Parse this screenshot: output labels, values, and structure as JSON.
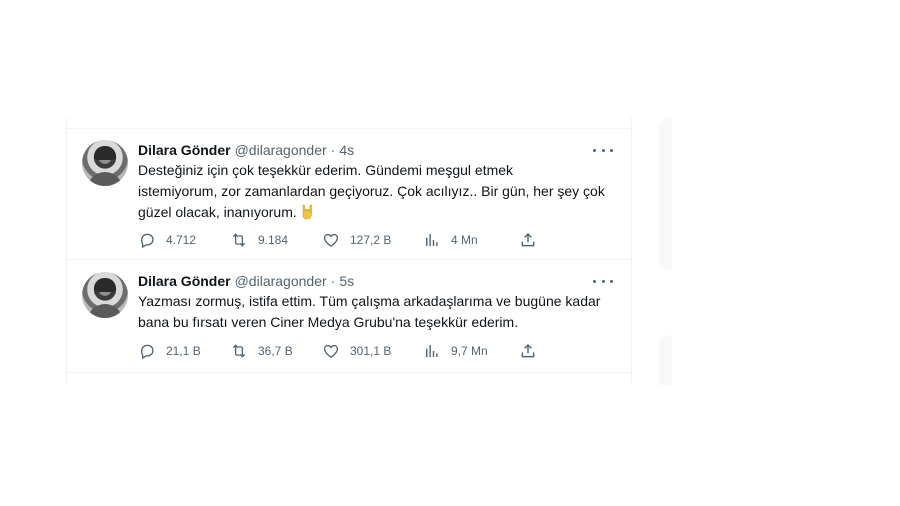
{
  "tweets": [
    {
      "name": "Dilara Gönder",
      "handle": "@dilaragonder",
      "separator": "·",
      "time": "4s",
      "text_lines": [
        "Desteğiniz için çok teşekkür ederim. Gündemi meşgul etmek",
        "istemiyorum, zor zamanlardan geçiyoruz. Çok acılıyız.. Bir gün, her şey çok",
        "güzel olacak, inanıyorum."
      ],
      "emoji": "sign-of-the-horns-icon",
      "replies": "4.712",
      "retweets": "9.184",
      "likes": "127,2 B",
      "views": "4 Mn"
    },
    {
      "name": "Dilara Gönder",
      "handle": "@dilaragonder",
      "separator": "·",
      "time": "5s",
      "text_lines": [
        "Yazması zormuş, istifa ettim. Tüm çalışma arkadaşlarıma ve bugüne kadar",
        "bana bu fırsatı veren Ciner Medya Grubu'na teşekkür ederim."
      ],
      "replies": "21,1 B",
      "retweets": "36,7 B",
      "likes": "301,1 B",
      "views": "9,7 Mn"
    }
  ],
  "icons": {
    "reply": "reply-icon",
    "retweet": "retweet-icon",
    "like": "like-icon",
    "views": "views-icon",
    "share": "share-icon",
    "more": "more-options-icon"
  },
  "colors": {
    "text": "#0f1419",
    "secondary": "#536471",
    "border": "#eff3f4",
    "emoji": "#f4c542"
  }
}
